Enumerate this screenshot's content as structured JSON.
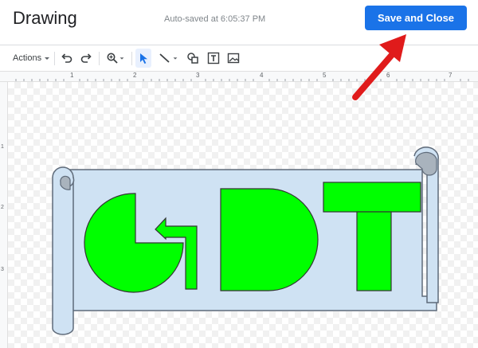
{
  "app": {
    "title": "Drawing",
    "autosave": "Auto-saved at 6:05:37 PM",
    "save_close_label": "Save and Close"
  },
  "toolbar": {
    "actions_label": "Actions",
    "icons": [
      "undo-icon",
      "redo-icon",
      "zoom-icon",
      "select-icon",
      "line-icon",
      "shape-icon",
      "text-box-icon",
      "image-icon"
    ]
  },
  "ruler": {
    "horizontal_labels": [
      "1",
      "2",
      "3",
      "4",
      "5",
      "6",
      "7"
    ],
    "vertical_labels": [
      "1",
      "2",
      "3"
    ]
  },
  "canvas": {
    "letters": [
      "G",
      "D",
      "T"
    ]
  },
  "colors": {
    "accent": "#1a73e8",
    "letter_fill": "#00ff00",
    "banner_fill": "#cfe2f3",
    "arrow_red": "#e01b1b"
  }
}
